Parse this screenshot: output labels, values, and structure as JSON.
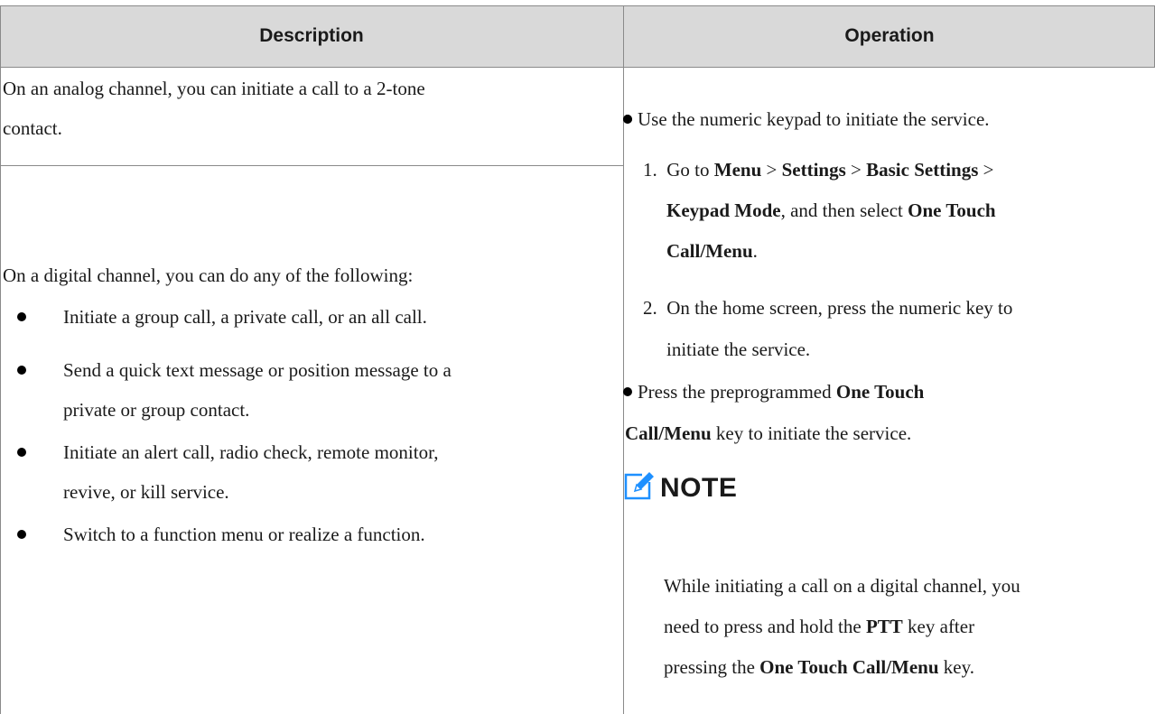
{
  "header": {
    "description": "Description",
    "operation": "Operation"
  },
  "description": {
    "analog_line1": "On an analog channel, you can initiate a call to a 2-tone",
    "analog_line2": "contact.",
    "digital_intro": "On a digital channel, you can do any of the following:",
    "items": [
      {
        "line1": "Initiate a group call, a private call, or an all call.",
        "line2": ""
      },
      {
        "line1": "Send a quick text message or position message to a",
        "line2": "private or group contact."
      },
      {
        "line1": "Initiate an alert call, radio check, remote monitor,",
        "line2": "revive, or kill service."
      },
      {
        "line1": "Switch to a function menu or realize a function.",
        "line2": ""
      }
    ]
  },
  "operation": {
    "bullet1": "Use the numeric keypad to initiate the service.",
    "step1": {
      "num": "1.",
      "go_to": "Go to",
      "menu": "Menu",
      "sep": ">",
      "settings": "Settings",
      "basic_settings": "Basic Settings",
      "keypad_mode": "Keypad Mode",
      "then_select": ", and then select",
      "one_touch": "One Touch",
      "call_menu": "Call/Menu",
      "period": "."
    },
    "step2": {
      "num": "2.",
      "line1": "On the home screen, press the numeric key to",
      "line2": "initiate the service."
    },
    "bullet2": {
      "press_the": "Press the preprogrammed",
      "one_touch": "One Touch",
      "call_menu": "Call/Menu",
      "rest": "key to initiate the service."
    },
    "note": {
      "title": "NOTE",
      "icon": "edit-note-icon",
      "line1": "While initiating a call on a digital channel, you",
      "line2_pre": "need to press and hold the",
      "ptt": "PTT",
      "line2_post": "key after",
      "line3_pre": "pressing the",
      "one_touch_call_menu": "One Touch Call/Menu",
      "line3_post": "key."
    }
  },
  "colors": {
    "header_bg": "#d9d9d9",
    "border": "#8a8a8a",
    "note_icon": "#1e90ff"
  }
}
